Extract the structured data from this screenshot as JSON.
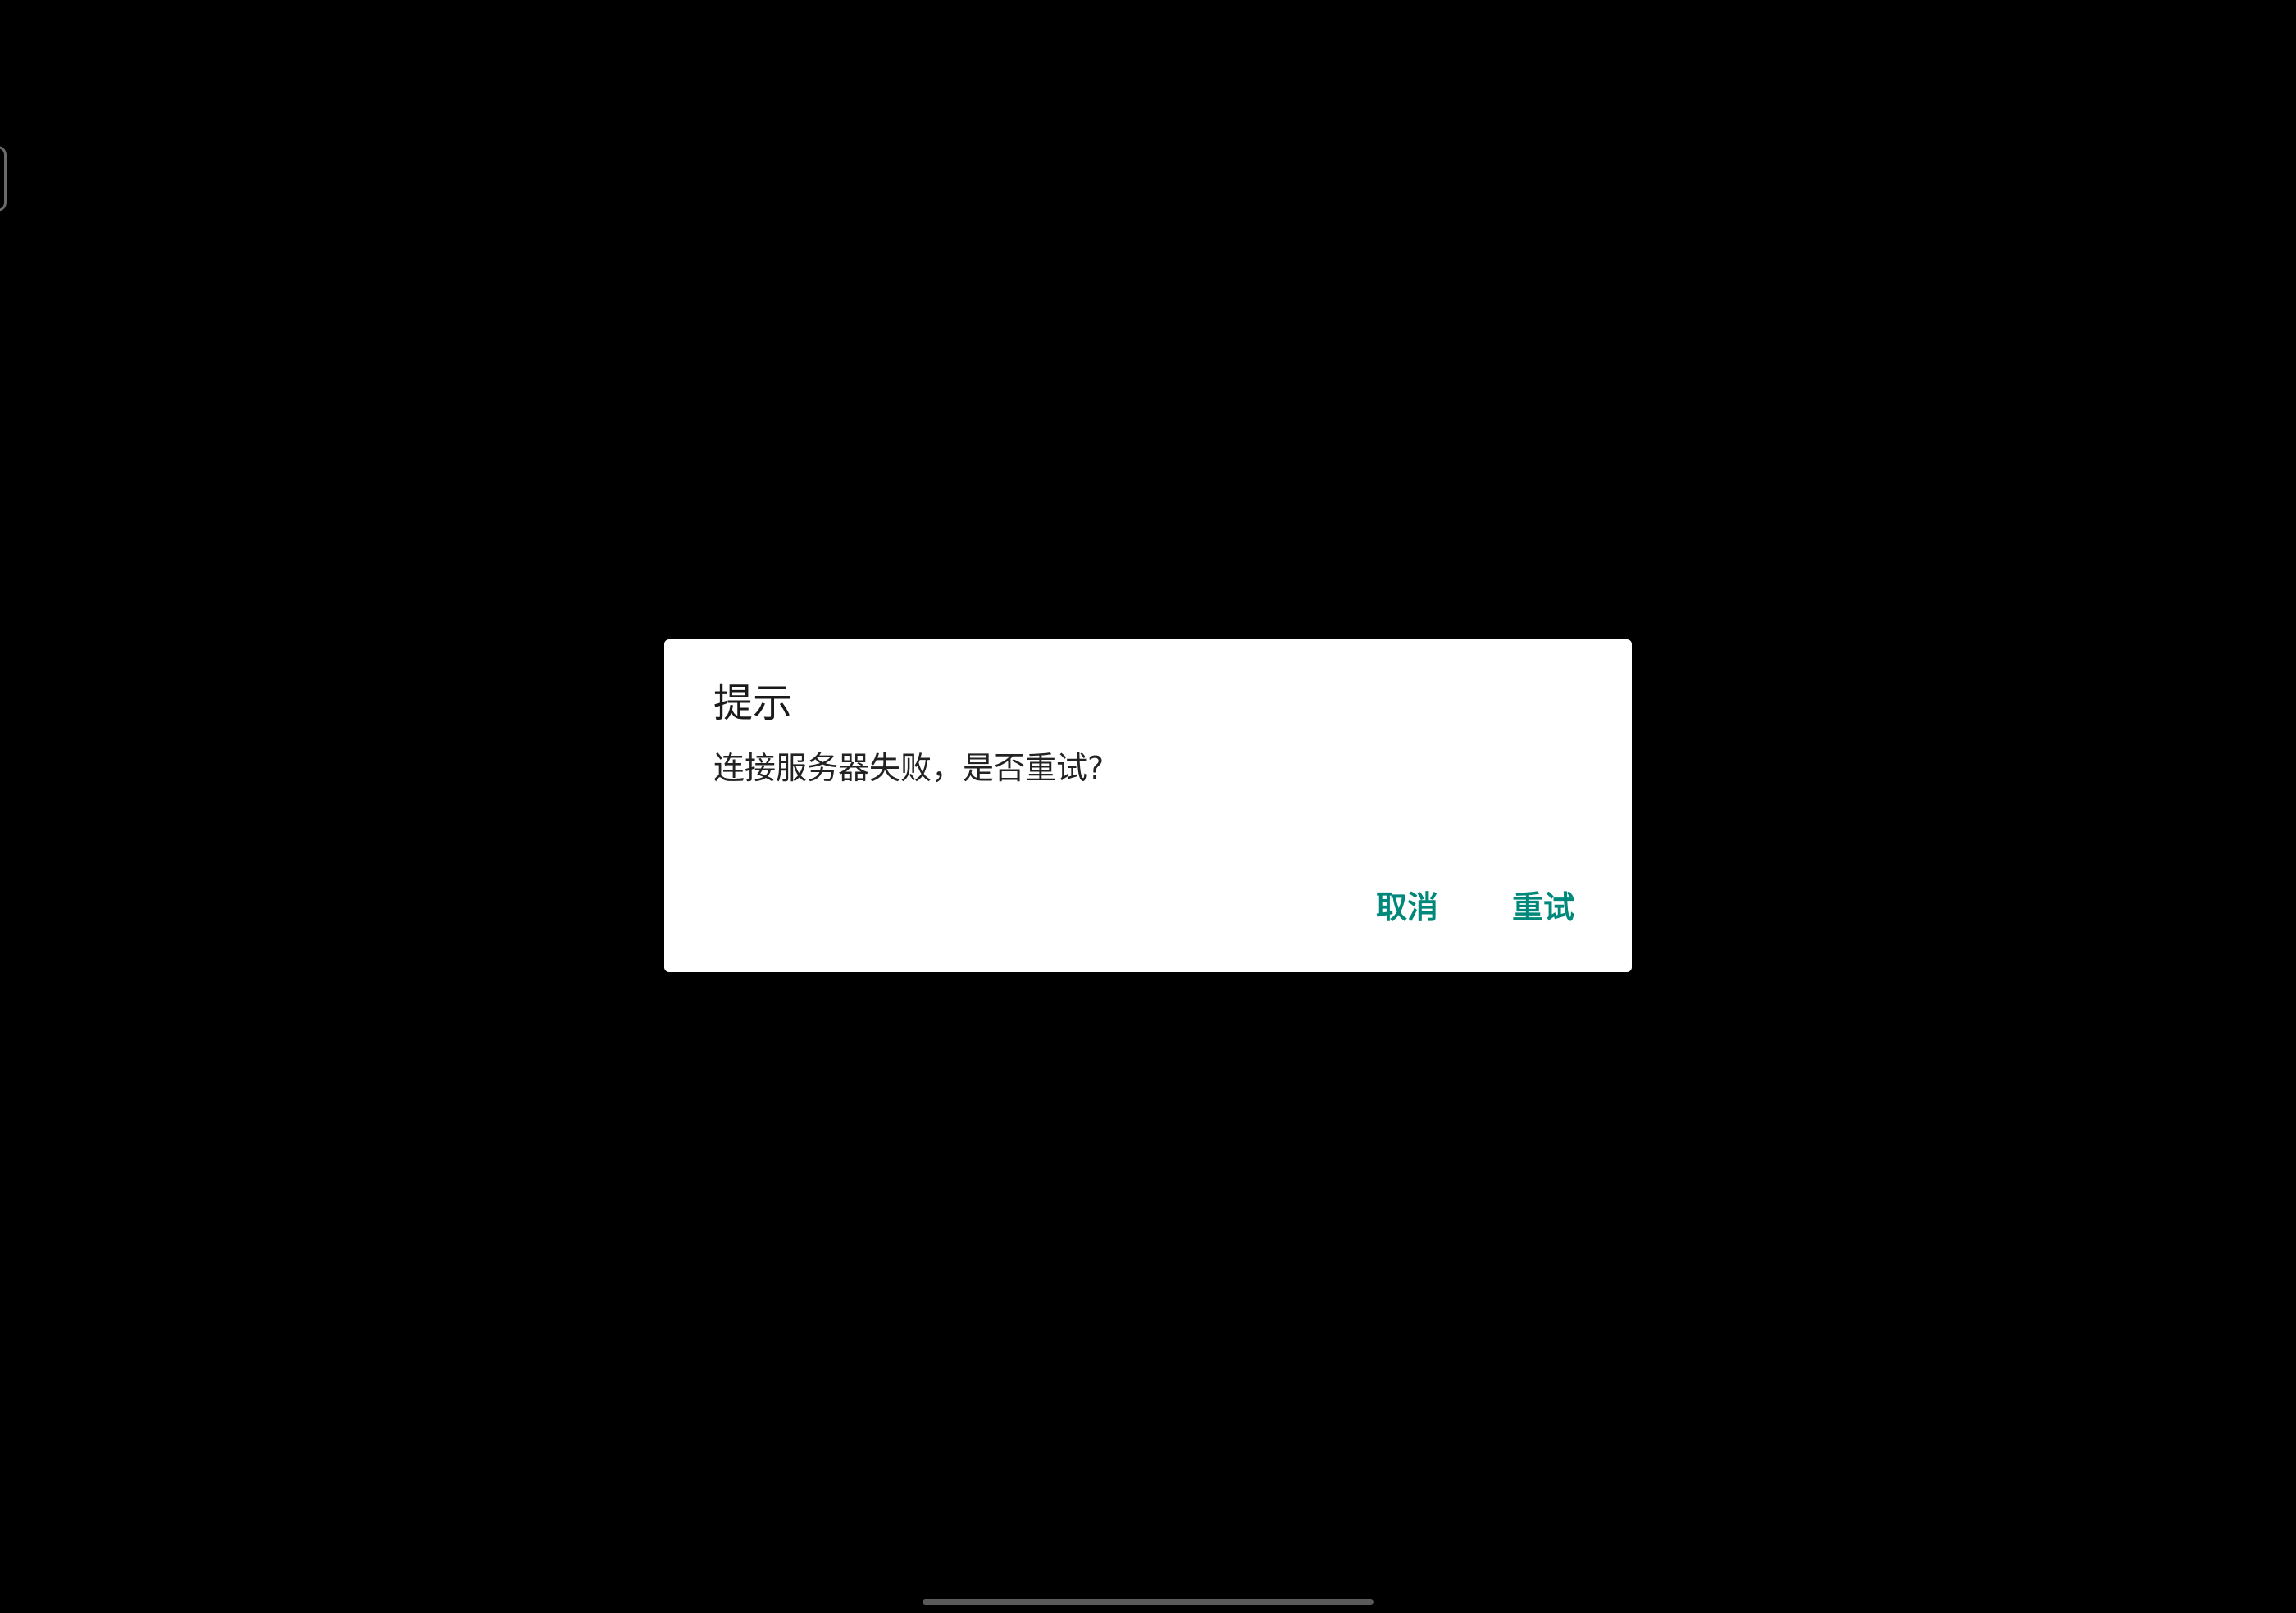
{
  "dialog": {
    "title": "提示",
    "message": "连接服务器失败，是否重试?",
    "cancel_label": "取消",
    "retry_label": "重试"
  },
  "colors": {
    "background": "#000000",
    "dialog_background": "#ffffff",
    "accent": "#00897b"
  },
  "icons": {
    "edge_handle": "side-panel-handle-icon",
    "home_indicator": "home-indicator-bar"
  }
}
